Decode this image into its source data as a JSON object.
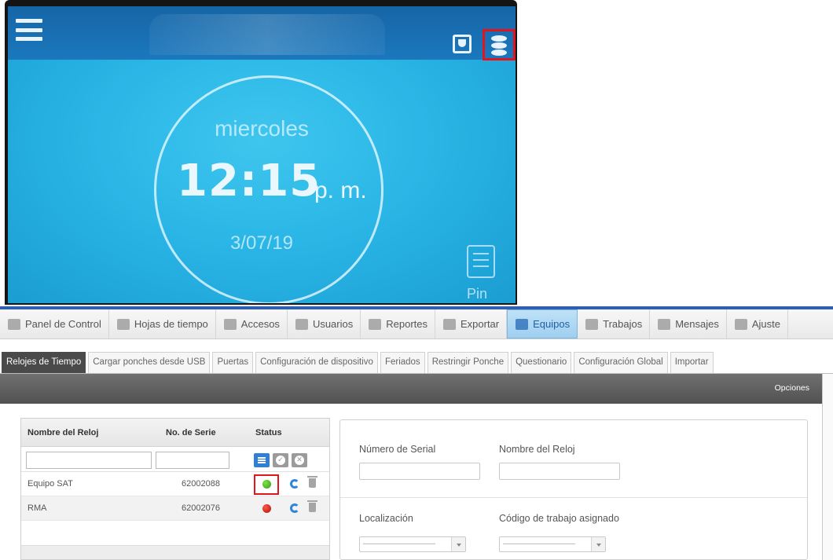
{
  "device": {
    "day": "miercoles",
    "time": "12:15",
    "ampm": "p. m.",
    "date": "3/07/19",
    "pin_label": "Pin"
  },
  "nav": {
    "items": [
      {
        "label": "Panel de Control",
        "icon": "dashboard-icon"
      },
      {
        "label": "Hojas de tiempo",
        "icon": "calendar-icon"
      },
      {
        "label": "Accesos",
        "icon": "door-icon"
      },
      {
        "label": "Usuarios",
        "icon": "user-icon"
      },
      {
        "label": "Reportes",
        "icon": "bar-chart-icon"
      },
      {
        "label": "Exportar",
        "icon": "export-icon"
      },
      {
        "label": "Equipos",
        "icon": "devices-icon",
        "active": true
      },
      {
        "label": "Trabajos",
        "icon": "jobs-icon"
      },
      {
        "label": "Mensajes",
        "icon": "message-icon"
      },
      {
        "label": "Ajuste",
        "icon": "tools-icon"
      }
    ],
    "accent_color": "#2f5fb0"
  },
  "tabs": [
    "Relojes de Tiempo",
    "Cargar ponches desde USB",
    "Puertas",
    "Configuración de dispositivo",
    "Feriados",
    "Restringir Ponche",
    "Questionario",
    "Configuración Global",
    "Importar"
  ],
  "options_label": "Opciones",
  "clocks_table": {
    "headers": {
      "name": "Nombre del Reloj",
      "serial": "No. de Serie",
      "status": "Status"
    },
    "filters": {
      "name": "",
      "serial": ""
    },
    "rows": [
      {
        "name": "Equipo SAT",
        "serial": "62002088",
        "status": "online",
        "status_color": "#2f9c10"
      },
      {
        "name": "RMA",
        "serial": "62002076",
        "status": "offline",
        "status_color": "#a8120a"
      }
    ]
  },
  "form": {
    "serial_label": "Número de Serial",
    "serial_value": "",
    "clock_name_label": "Nombre del Reloj",
    "clock_name_value": "",
    "location_label": "Localización",
    "job_code_label": "Código de trabajo asignado"
  }
}
